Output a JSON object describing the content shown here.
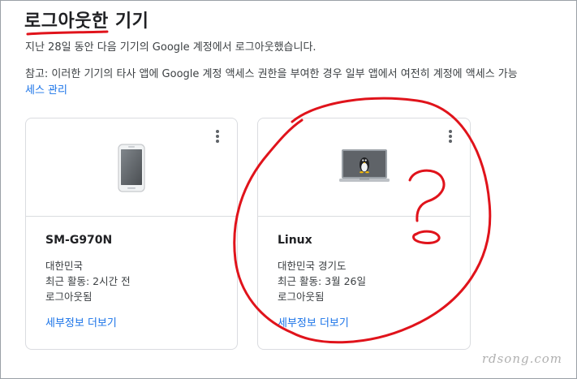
{
  "page": {
    "title": "로그아웃한 기기",
    "subtitle": "지난 28일 동안 다음 기기의 Google 계정에서 로그아웃했습니다.",
    "note": "참고: 이러한 기기의 타사 앱에 Google 계정 액세스 권한을 부여한 경우 일부 앱에서 여전히 계정에 액세스 가능",
    "manage_link": "세스 관리"
  },
  "devices": [
    {
      "name": "SM-G970N",
      "location": "대한민국",
      "activity": "최근 활동: 2시간 전",
      "status": "로그아웃됨",
      "details_link": "세부정보 더보기",
      "icon": "phone-icon"
    },
    {
      "name": "Linux",
      "location": "대한민국 경기도",
      "activity": "최근 활동: 3월 26일",
      "status": "로그아웃됨",
      "details_link": "세부정보 더보기",
      "icon": "linux-laptop-icon"
    }
  ],
  "watermark": "rdsong.com",
  "colors": {
    "link": "#1a73e8",
    "annotation": "#e0131b",
    "border": "#dadce0"
  }
}
